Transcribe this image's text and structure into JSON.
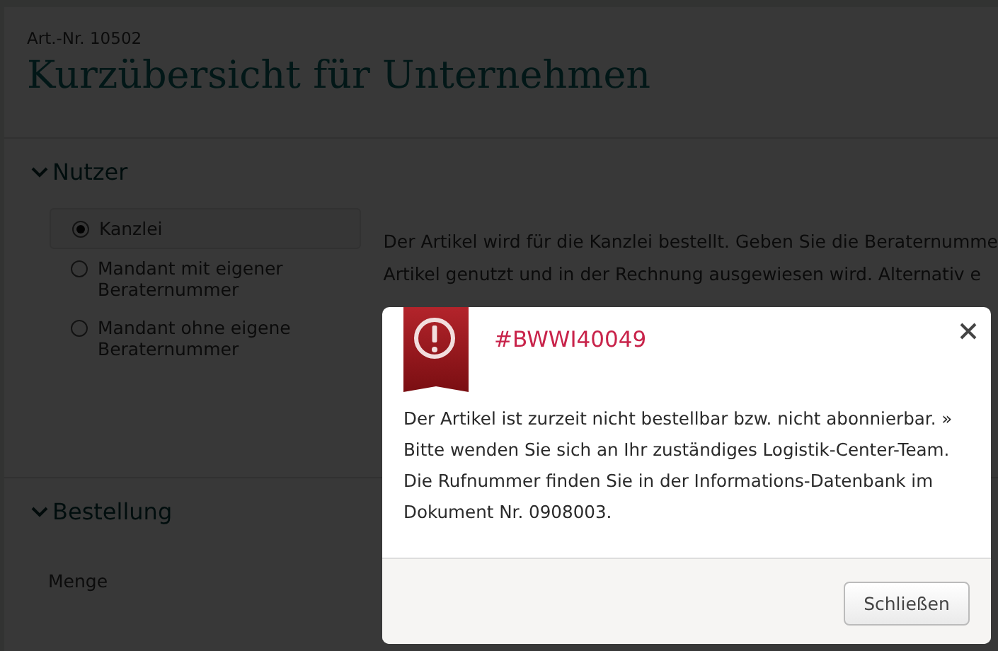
{
  "page": {
    "article_number": "Art.-Nr. 10502",
    "title": "Kurzübersicht für Unternehmen"
  },
  "user_section": {
    "title": "Nutzer",
    "options": [
      {
        "label": "Kanzlei",
        "selected": true
      },
      {
        "label": "Mandant mit eigener Beraternummer",
        "selected": false
      },
      {
        "label": "Mandant ohne eigene Beraternummer",
        "selected": false
      }
    ],
    "description_lines": [
      "Der Artikel wird für die Kanzlei bestellt. Geben Sie die Beraternumme",
      "Artikel genutzt und in der Rechnung ausgewiesen wird. Alternativ e"
    ]
  },
  "order_section": {
    "title": "Bestellung",
    "quantity_label": "Menge"
  },
  "dialog": {
    "title": "#BWWI40049",
    "message_lines": [
      "Der Artikel ist zurzeit nicht bestellbar bzw. nicht abonnierbar. »",
      "Bitte wenden Sie sich an Ihr zuständiges Logistik-Center-Team.",
      "Die Rufnummer finden Sie in der Informations-Datenbank im",
      "Dokument Nr. 0908003."
    ],
    "button": "Schließen"
  }
}
